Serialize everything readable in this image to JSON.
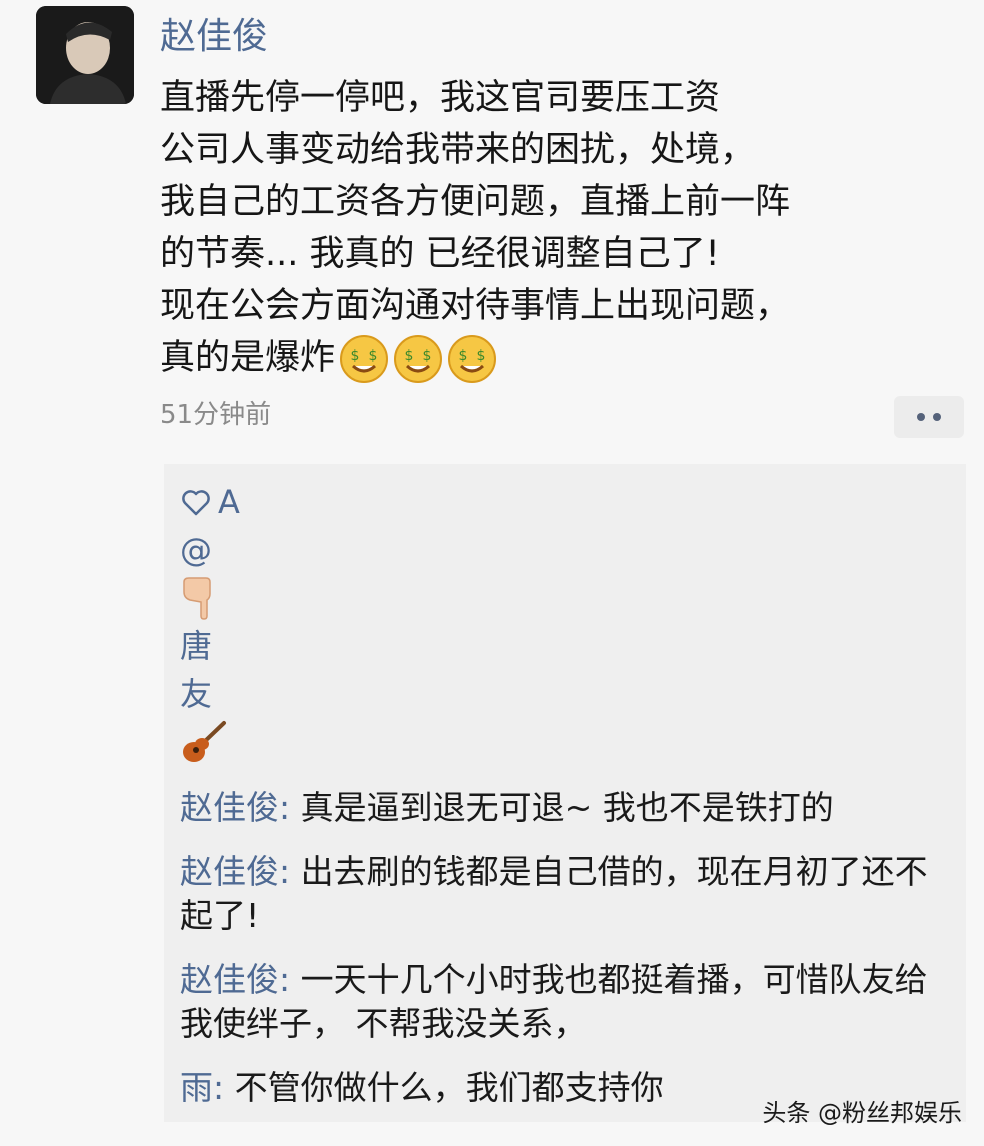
{
  "post": {
    "author": "赵佳俊",
    "lines": [
      "直播先停一停吧，我这官司要压工资",
      "公司人事变动给我带来的困扰，处境，",
      "我自己的工资各方便问题，直播上前一阵",
      "的节奏... 我真的 已经很调整自己了!",
      "现在公会方面沟通对待事情上出现问题，",
      "真的是爆炸"
    ],
    "emojis": [
      "money-face-emoji",
      "money-face-emoji",
      "money-face-emoji"
    ],
    "time": "51分钟前"
  },
  "likes": {
    "items": [
      "A",
      "@",
      "",
      "唐",
      "友",
      ""
    ]
  },
  "comments": [
    {
      "name": "赵佳俊",
      "sep": ": ",
      "text": "真是逼到退无可退~ 我也不是铁打的"
    },
    {
      "name": "赵佳俊",
      "sep": ": ",
      "text": "出去刷的钱都是自己借的，现在月初了还不起了!"
    },
    {
      "name": "赵佳俊",
      "sep": ": ",
      "text": "一天十几个小时我也都挺着播，可惜队友给我使绊子，  不帮我没关系，"
    },
    {
      "name": "雨",
      "sep": ": ",
      "text": "不管你做什么，我们都支持你"
    }
  ],
  "watermark": "头条 @粉丝邦娱乐",
  "colors": {
    "name": "#4f6a93",
    "text": "#161616",
    "panel": "#efefef",
    "time": "#8a8a8a"
  }
}
